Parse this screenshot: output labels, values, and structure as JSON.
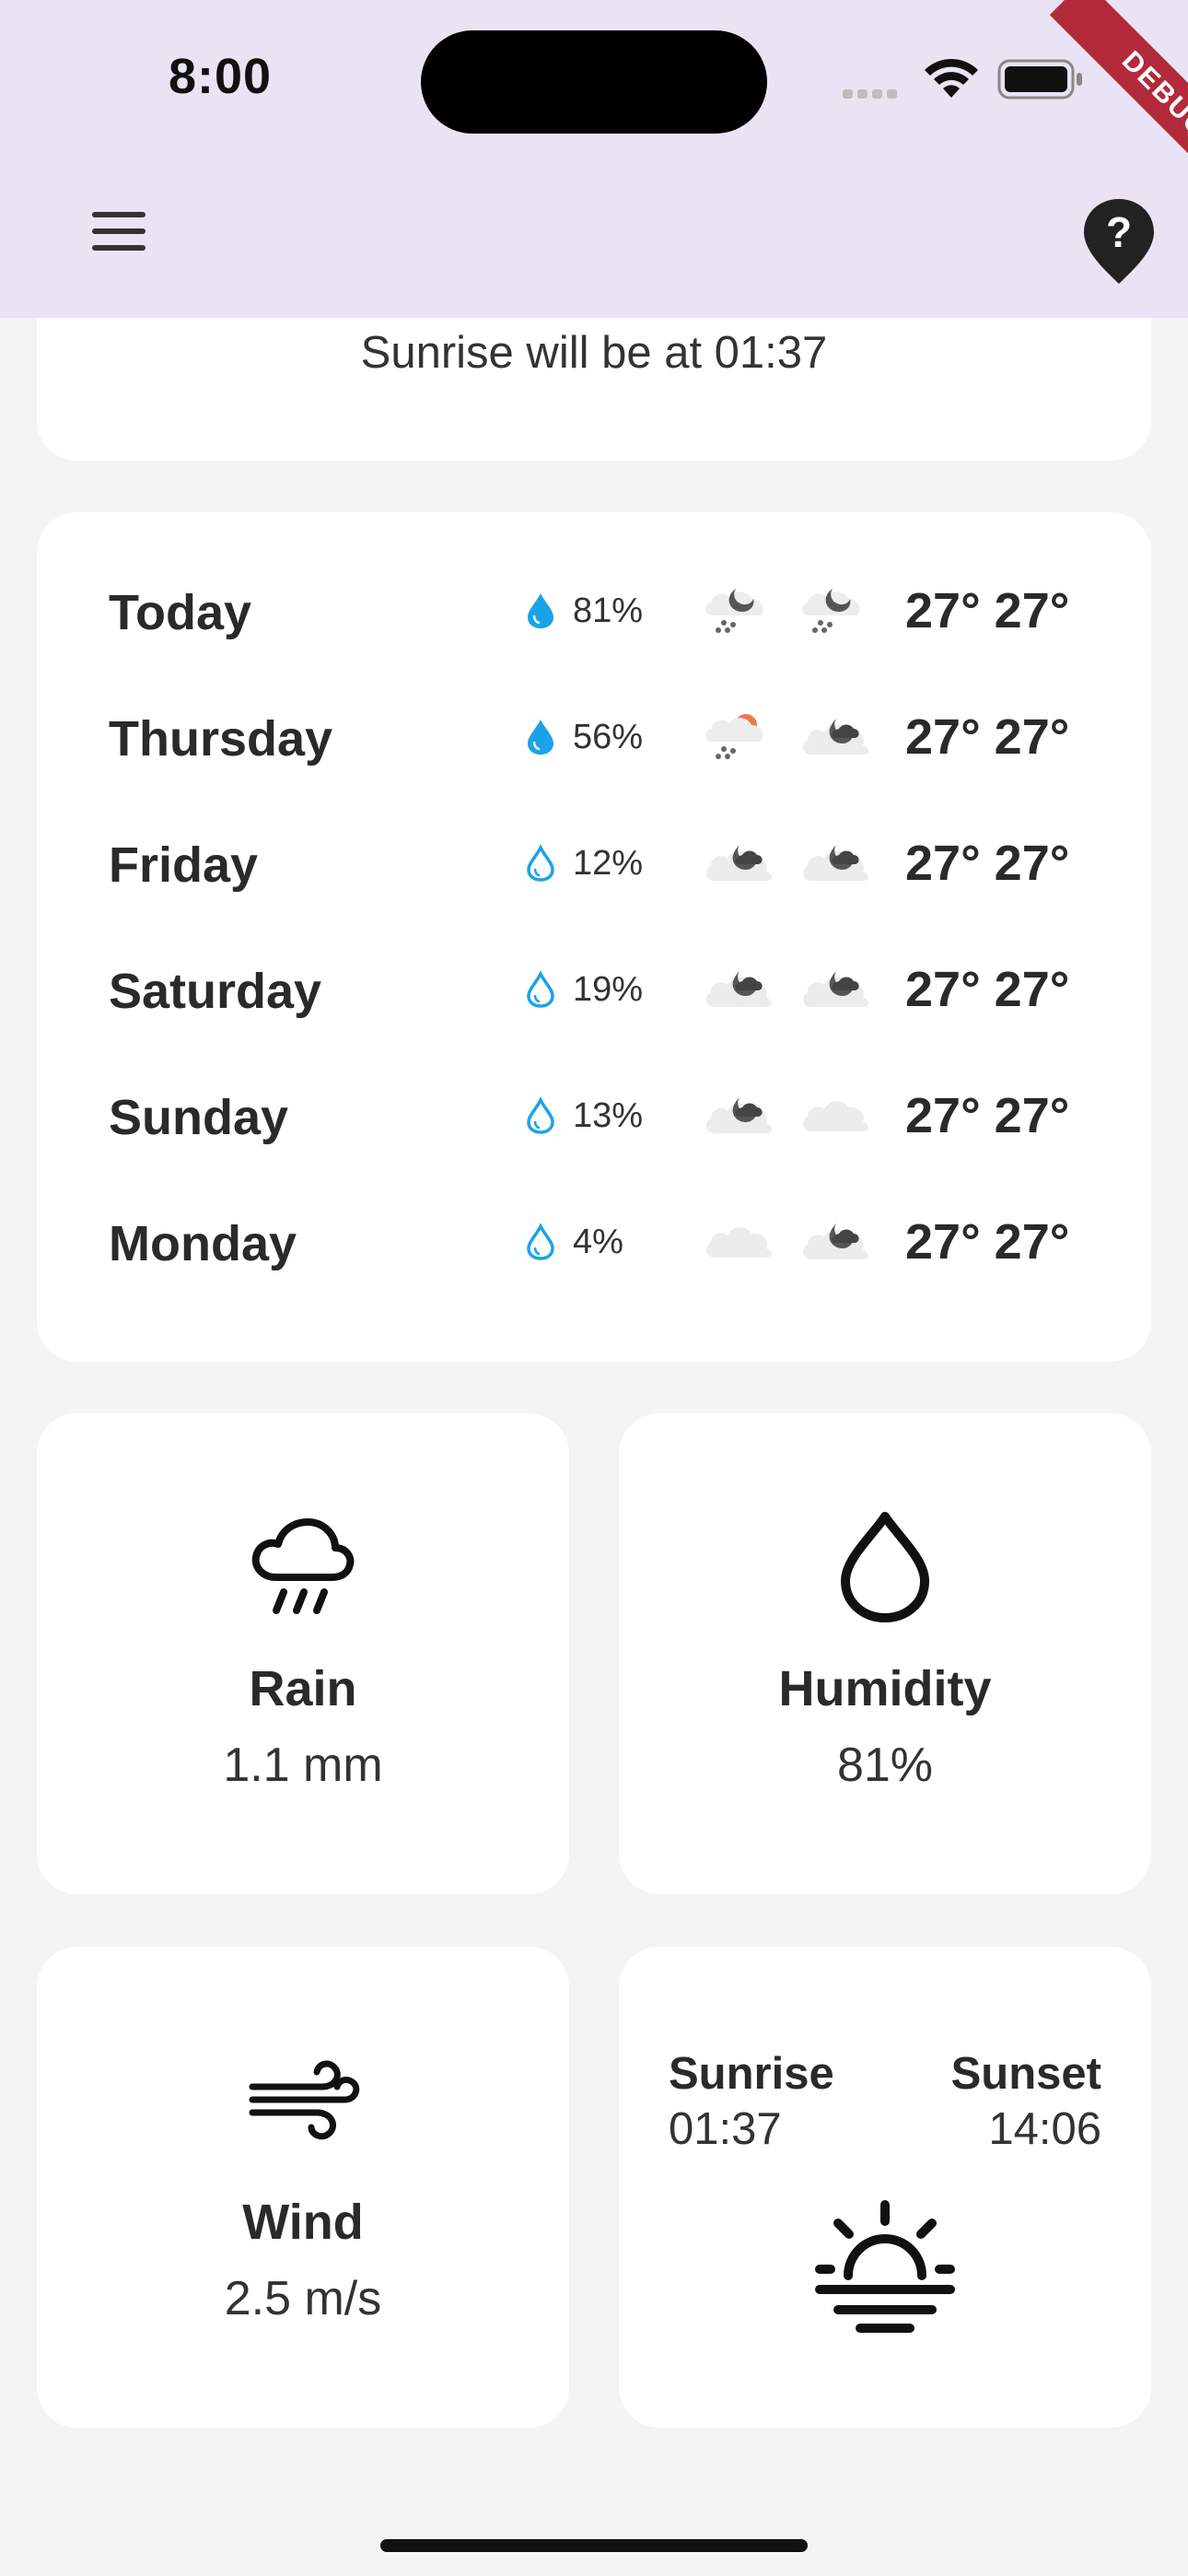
{
  "status_bar": {
    "time": "8:00"
  },
  "debug_banner": "DEBUG",
  "app_bar": {
    "menu_icon": "menu-icon",
    "help_icon": "location-help-icon"
  },
  "sunrise_notice": "Sunrise will be at 01:37",
  "forecast": [
    {
      "day": "Today",
      "precip": "81%",
      "drop": "filled",
      "icon_day": "night-snow",
      "icon_night": "night-snow",
      "temps": "27° 27°"
    },
    {
      "day": "Thursday",
      "precip": "56%",
      "drop": "filled",
      "icon_day": "day-snow",
      "icon_night": "cloudy-night",
      "temps": "27° 27°"
    },
    {
      "day": "Friday",
      "precip": "12%",
      "drop": "outline",
      "icon_day": "cloudy-night",
      "icon_night": "cloudy-night",
      "temps": "27° 27°"
    },
    {
      "day": "Saturday",
      "precip": "19%",
      "drop": "outline",
      "icon_day": "cloudy-night",
      "icon_night": "cloudy-night",
      "temps": "27° 27°"
    },
    {
      "day": "Sunday",
      "precip": "13%",
      "drop": "outline",
      "icon_day": "cloudy-night",
      "icon_night": "cloud",
      "temps": "27° 27°"
    },
    {
      "day": "Monday",
      "precip": "4%",
      "drop": "outline",
      "icon_day": "cloud",
      "icon_night": "cloudy-night",
      "temps": "27° 27°"
    }
  ],
  "tiles": {
    "rain": {
      "title": "Rain",
      "value": "1.1 mm",
      "icon": "rain-icon"
    },
    "humidity": {
      "title": "Humidity",
      "value": "81%",
      "icon": "droplet-icon"
    },
    "wind": {
      "title": "Wind",
      "value": "2.5 m/s",
      "icon": "wind-icon"
    },
    "sun": {
      "sunrise_label": "Sunrise",
      "sunrise_time": "01:37",
      "sunset_label": "Sunset",
      "sunset_time": "14:06",
      "icon": "sunrise-icon"
    }
  },
  "colors": {
    "appbar": "#e9e3f4",
    "background": "#f4f4f4",
    "drop": "#1aa3e8",
    "sun_orange": "#f07850",
    "debug": "#b32a3a"
  }
}
